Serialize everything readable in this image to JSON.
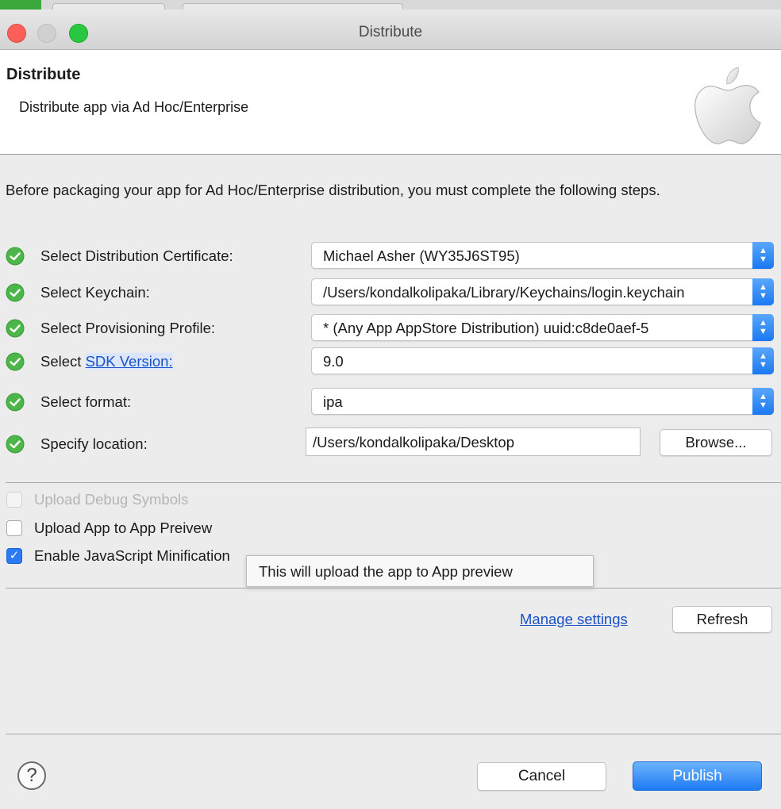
{
  "window": {
    "title": "Distribute"
  },
  "header": {
    "title": "Distribute",
    "subtitle": "Distribute app via Ad Hoc/Enterprise",
    "logo_icon": "apple-logo-icon"
  },
  "intro": "Before packaging your app for Ad Hoc/Enterprise distribution, you must complete the following steps.",
  "steps": {
    "certificate": {
      "label": "Select Distribution Certificate:",
      "value": "Michael Asher (WY35J6ST95)"
    },
    "keychain": {
      "label": "Select Keychain:",
      "value": "/Users/kondalkolipaka/Library/Keychains/login.keychain"
    },
    "profile": {
      "label": "Select Provisioning Profile:",
      "value": "* (Any App AppStore Distribution) uuid:c8de0aef-5"
    },
    "sdk": {
      "label_prefix": "Select ",
      "link": "SDK Version",
      "label_suffix": ":",
      "value": "9.0"
    },
    "format": {
      "label": "Select format:",
      "value": "ipa"
    },
    "location": {
      "label": "Specify location:",
      "value": "/Users/kondalkolipaka/Desktop",
      "browse_label": "Browse..."
    }
  },
  "options": {
    "debug_symbols": {
      "label": "Upload Debug Symbols",
      "checked": false,
      "enabled": false
    },
    "app_preview": {
      "label": "Upload App to App Preivew",
      "checked": false,
      "enabled": true
    },
    "minification": {
      "label": "Enable JavaScript Minification",
      "checked": true,
      "enabled": true
    }
  },
  "tooltip": "This will upload the app to App preview",
  "settings": {
    "manage_label": "Manage settings",
    "refresh_label": "Refresh"
  },
  "footer": {
    "help_label": "?",
    "cancel_label": "Cancel",
    "publish_label": "Publish"
  },
  "colors": {
    "accent": "#1f7bf3",
    "success": "#4db64a",
    "link": "#1a52c7"
  }
}
